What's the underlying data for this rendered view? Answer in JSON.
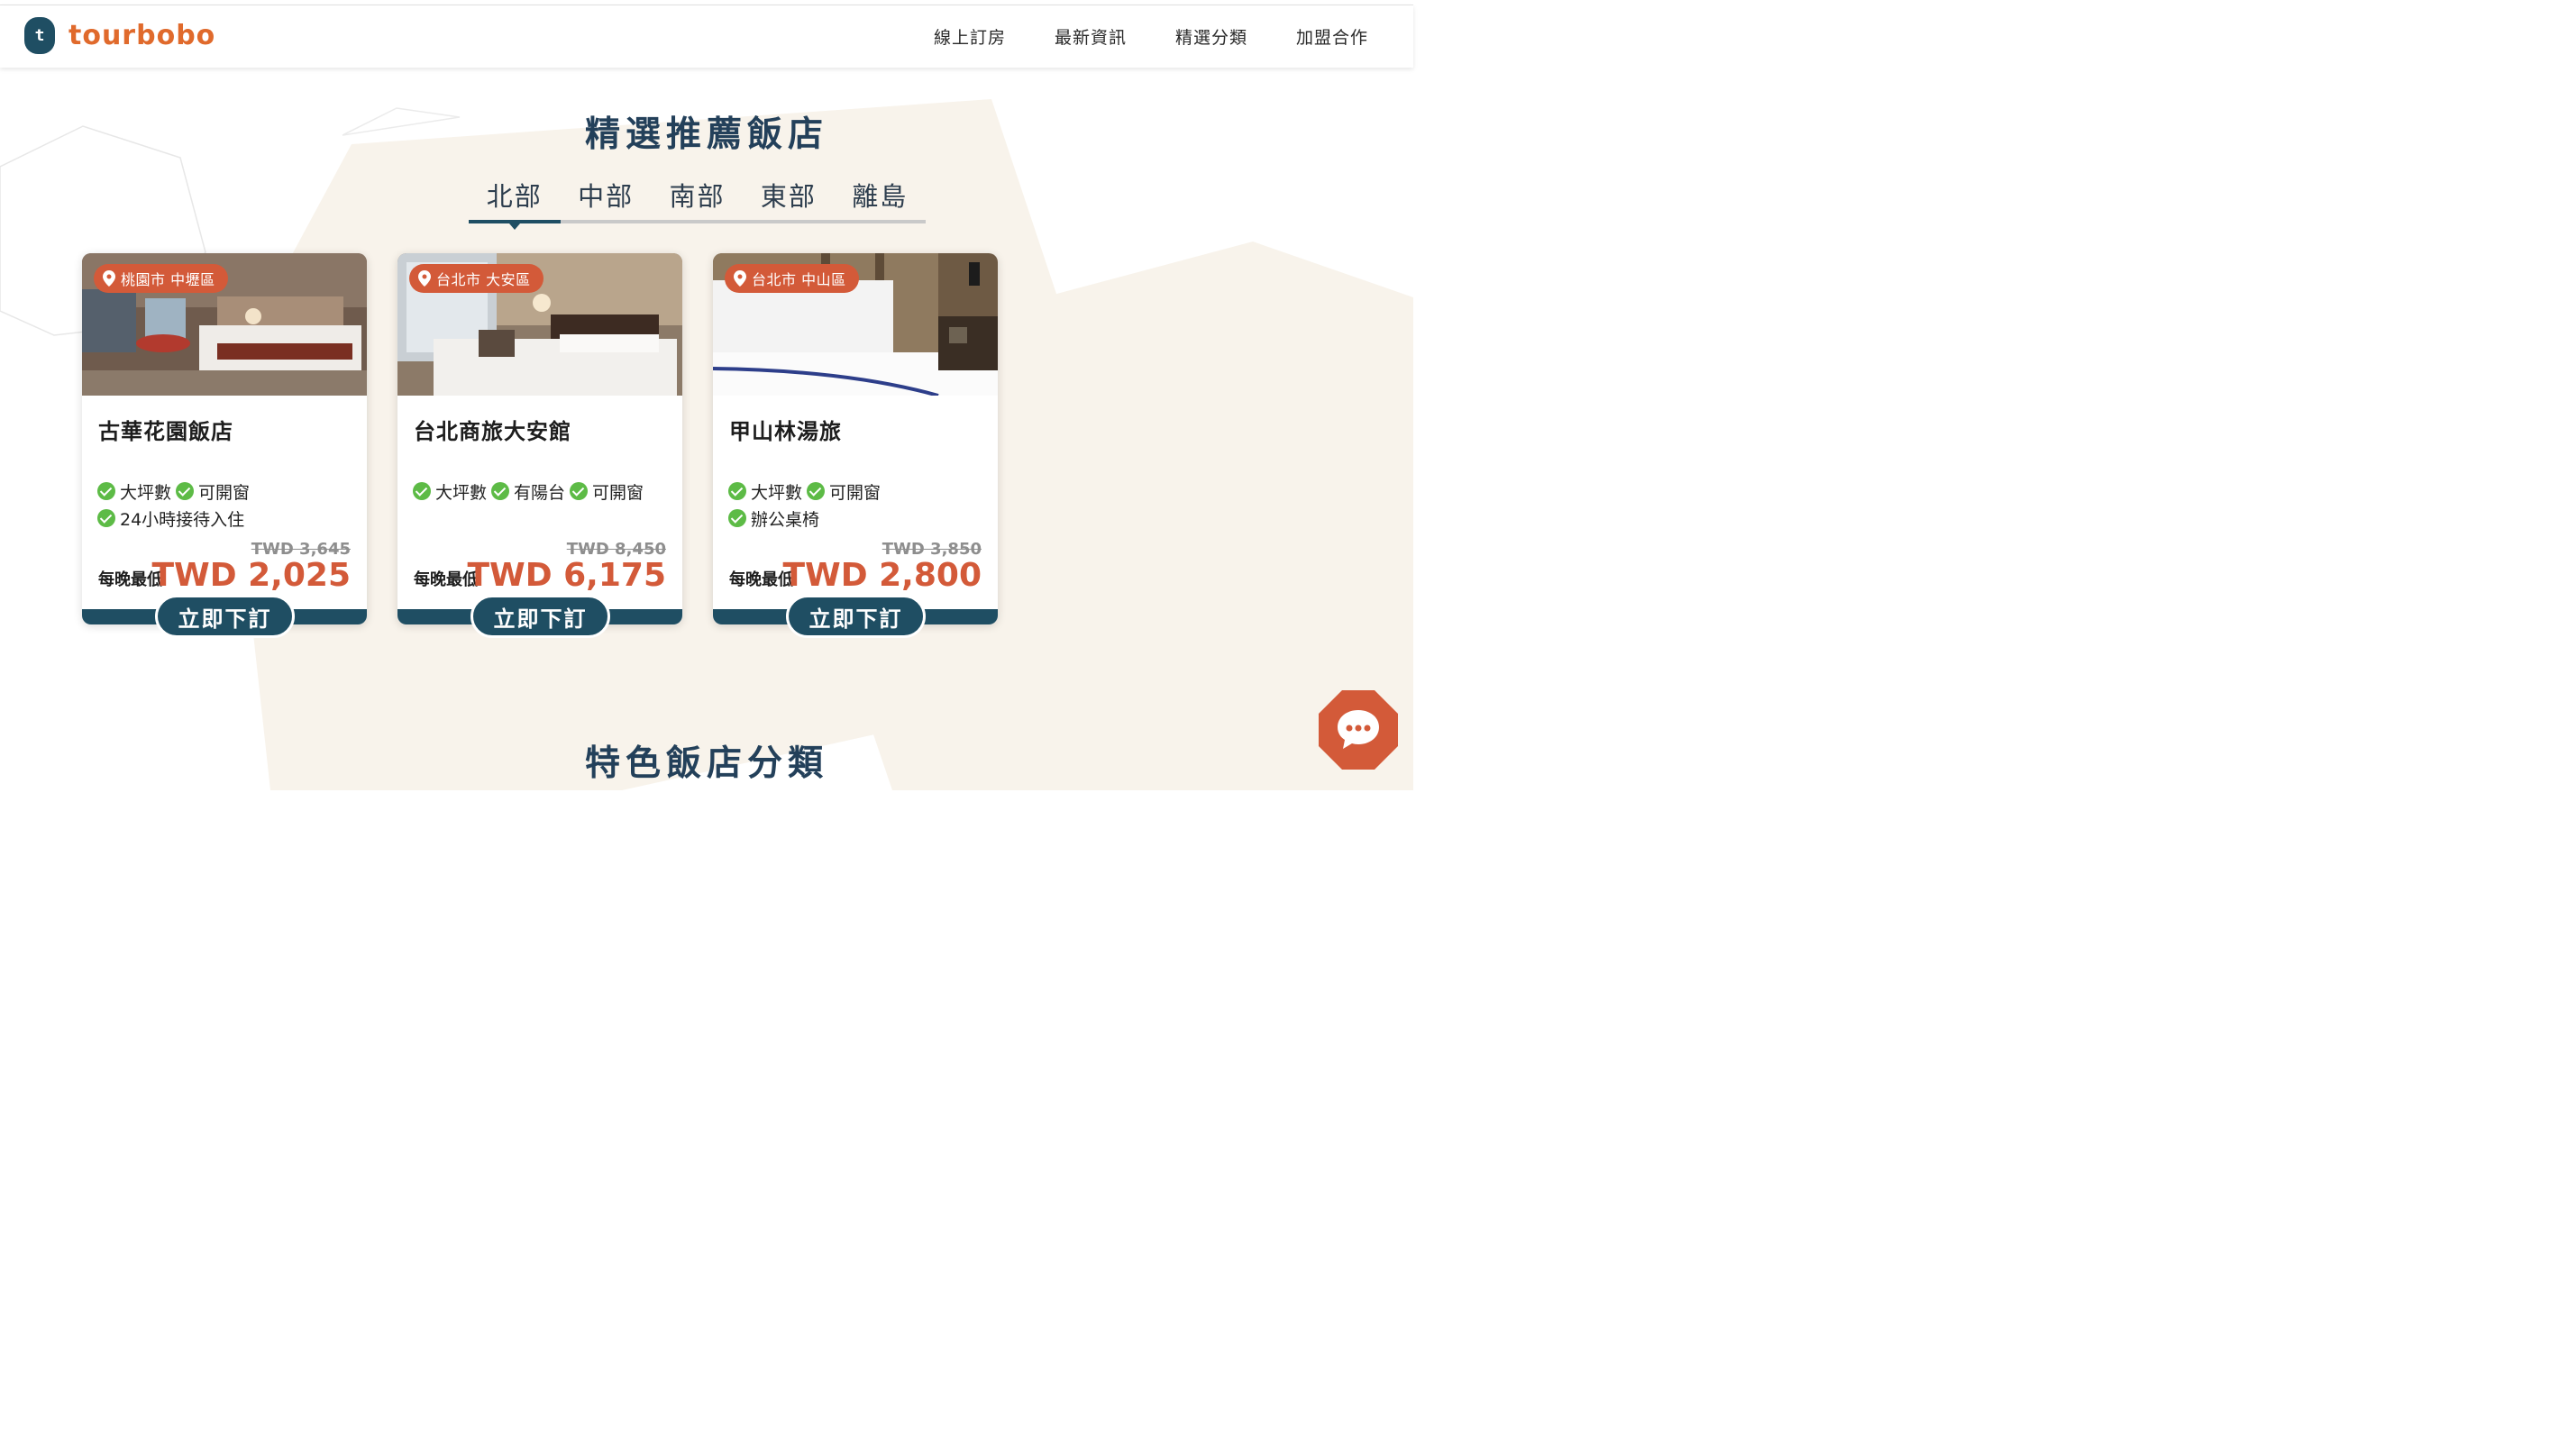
{
  "header": {
    "logo_mark": "t",
    "logo_text": "tourbobo",
    "nav": [
      "線上訂房",
      "最新資訊",
      "精選分類",
      "加盟合作"
    ]
  },
  "featured": {
    "title": "精選推薦飯店",
    "tabs": [
      "北部",
      "中部",
      "南部",
      "東部",
      "離島"
    ],
    "active_tab": "北部"
  },
  "cards": [
    {
      "location": "桃園市 中壢區",
      "name": "古華花園飯店",
      "features": [
        [
          "大坪數",
          "可開窗"
        ],
        [
          "24小時接待入住"
        ]
      ],
      "old_price": "TWD 3,645",
      "per_night": "每晚最低",
      "price": "TWD 2,025",
      "cta": "立即下訂"
    },
    {
      "location": "台北市 大安區",
      "name": "台北商旅大安館",
      "features": [
        [
          "大坪數",
          "有陽台",
          "可開窗"
        ]
      ],
      "old_price": "TWD 8,450",
      "per_night": "每晚最低",
      "price": "TWD 6,175",
      "cta": "立即下訂"
    },
    {
      "location": "台北市 中山區",
      "name": "甲山林湯旅",
      "features": [
        [
          "大坪數",
          "可開窗"
        ],
        [
          "辦公桌椅"
        ]
      ],
      "old_price": "TWD 3,850",
      "per_night": "每晚最低",
      "price": "TWD 2,800",
      "cta": "立即下訂"
    }
  ],
  "categories_section": {
    "title": "特色飯店分類"
  },
  "colors": {
    "primary": "#1f4e63",
    "accent": "#d35a39",
    "check": "#5dbb46",
    "bg_shape": "#f8f3eb"
  },
  "icons": {
    "chat": "chat-bubble-icon",
    "location": "map-pin-icon",
    "check": "check-circle-icon"
  }
}
